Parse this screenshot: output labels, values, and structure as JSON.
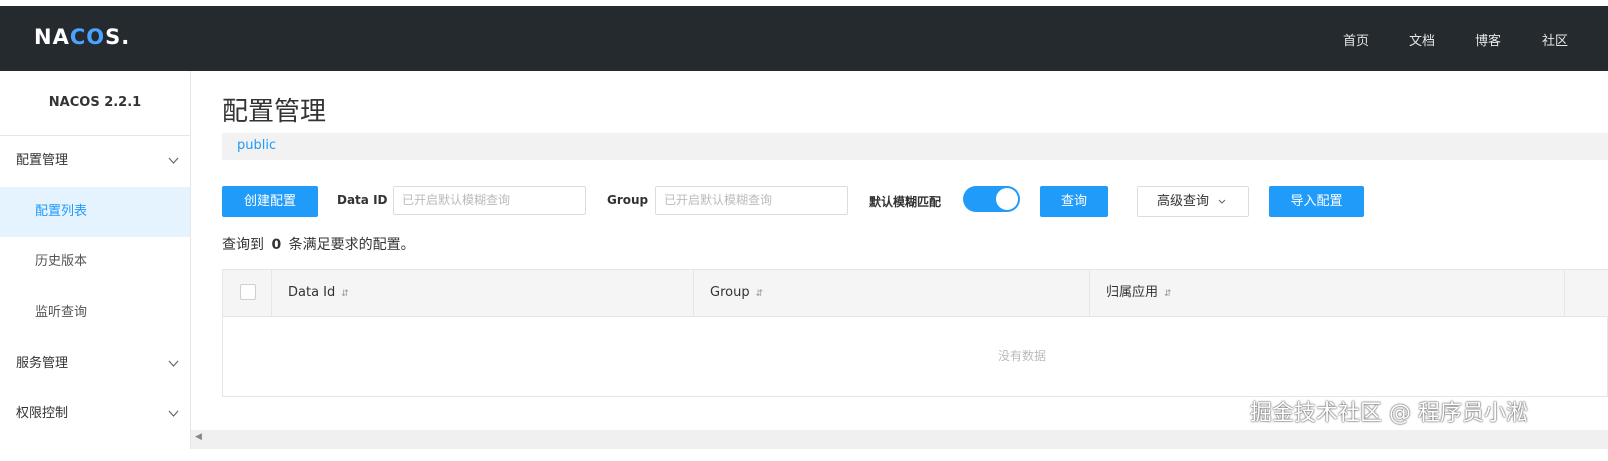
{
  "header": {
    "logo_text_a": "NA",
    "logo_text_b": "CO",
    "logo_text_c": "S.",
    "nav": [
      "首页",
      "文档",
      "博客",
      "社区"
    ]
  },
  "sidebar": {
    "version": "NACOS 2.2.1",
    "groups": [
      {
        "label": "配置管理",
        "items": [
          "配置列表",
          "历史版本",
          "监听查询"
        ]
      },
      {
        "label": "服务管理"
      },
      {
        "label": "权限控制"
      }
    ],
    "active_item": "配置列表"
  },
  "main": {
    "title": "配置管理",
    "namespace": "public",
    "toolbar": {
      "create_label": "创建配置",
      "data_id_label": "Data ID",
      "data_id_placeholder": "已开启默认模糊查询",
      "group_label": "Group",
      "group_placeholder": "已开启默认模糊查询",
      "fuzzy_label": "默认模糊匹配",
      "fuzzy_enabled": true,
      "query_label": "查询",
      "advanced_label": "高级查询",
      "import_label": "导入配置"
    },
    "result": {
      "prefix": "查询到",
      "count": "0",
      "suffix": "条满足要求的配置。"
    },
    "table": {
      "columns": [
        "Data Id",
        "Group",
        "归属应用"
      ],
      "empty_text": "没有数据"
    }
  },
  "watermark": "掘金技术社区 @ 程序员小淞",
  "colors": {
    "header_bg": "#252a2f",
    "accent": "#209bfa",
    "active_bg": "#e5f3ff"
  }
}
